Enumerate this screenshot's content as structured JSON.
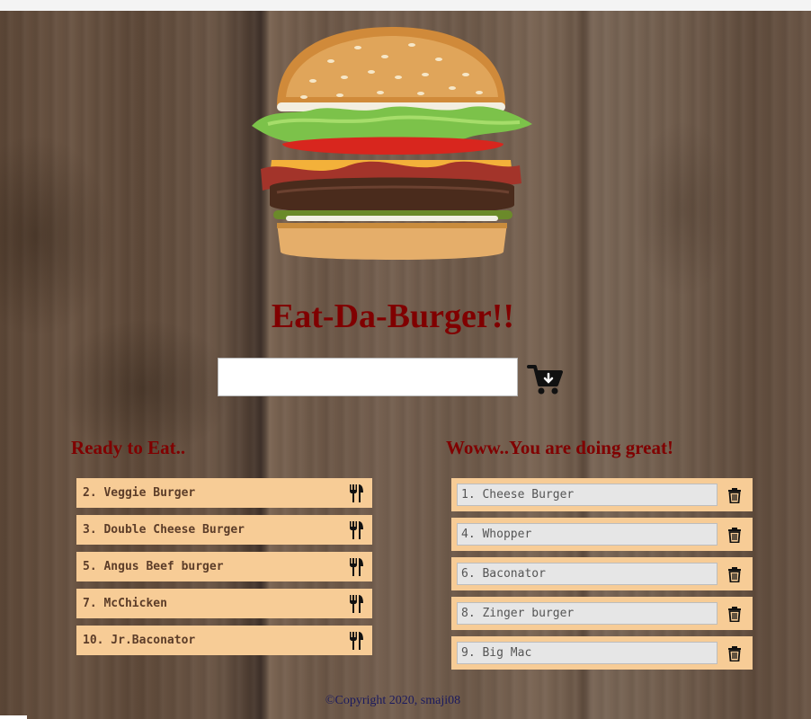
{
  "page": {
    "title": "Eat-Da-Burger!!",
    "title_color": "#800000"
  },
  "order": {
    "input_value": "",
    "submit_icon": "cart-plus-icon"
  },
  "ready": {
    "heading": "Ready to Eat..",
    "action_icon": "utensils-icon",
    "items": [
      {
        "label": "2. Veggie Burger"
      },
      {
        "label": "3. Double Cheese Burger"
      },
      {
        "label": "5. Angus Beef burger"
      },
      {
        "label": "7. McChicken"
      },
      {
        "label": "10. Jr.Baconator"
      }
    ]
  },
  "devoured": {
    "heading": "Woww..You are doing great!",
    "action_icon": "trash-icon",
    "items": [
      {
        "label": "1. Cheese Burger"
      },
      {
        "label": "4. Whopper"
      },
      {
        "label": "6. Baconator"
      },
      {
        "label": "8. Zinger burger"
      },
      {
        "label": "9. Big Mac"
      }
    ]
  },
  "footer": {
    "copyright": "©Copyright 2020, smaji08"
  },
  "colors": {
    "item_bg": "#f7cc96",
    "heading": "#800000"
  }
}
